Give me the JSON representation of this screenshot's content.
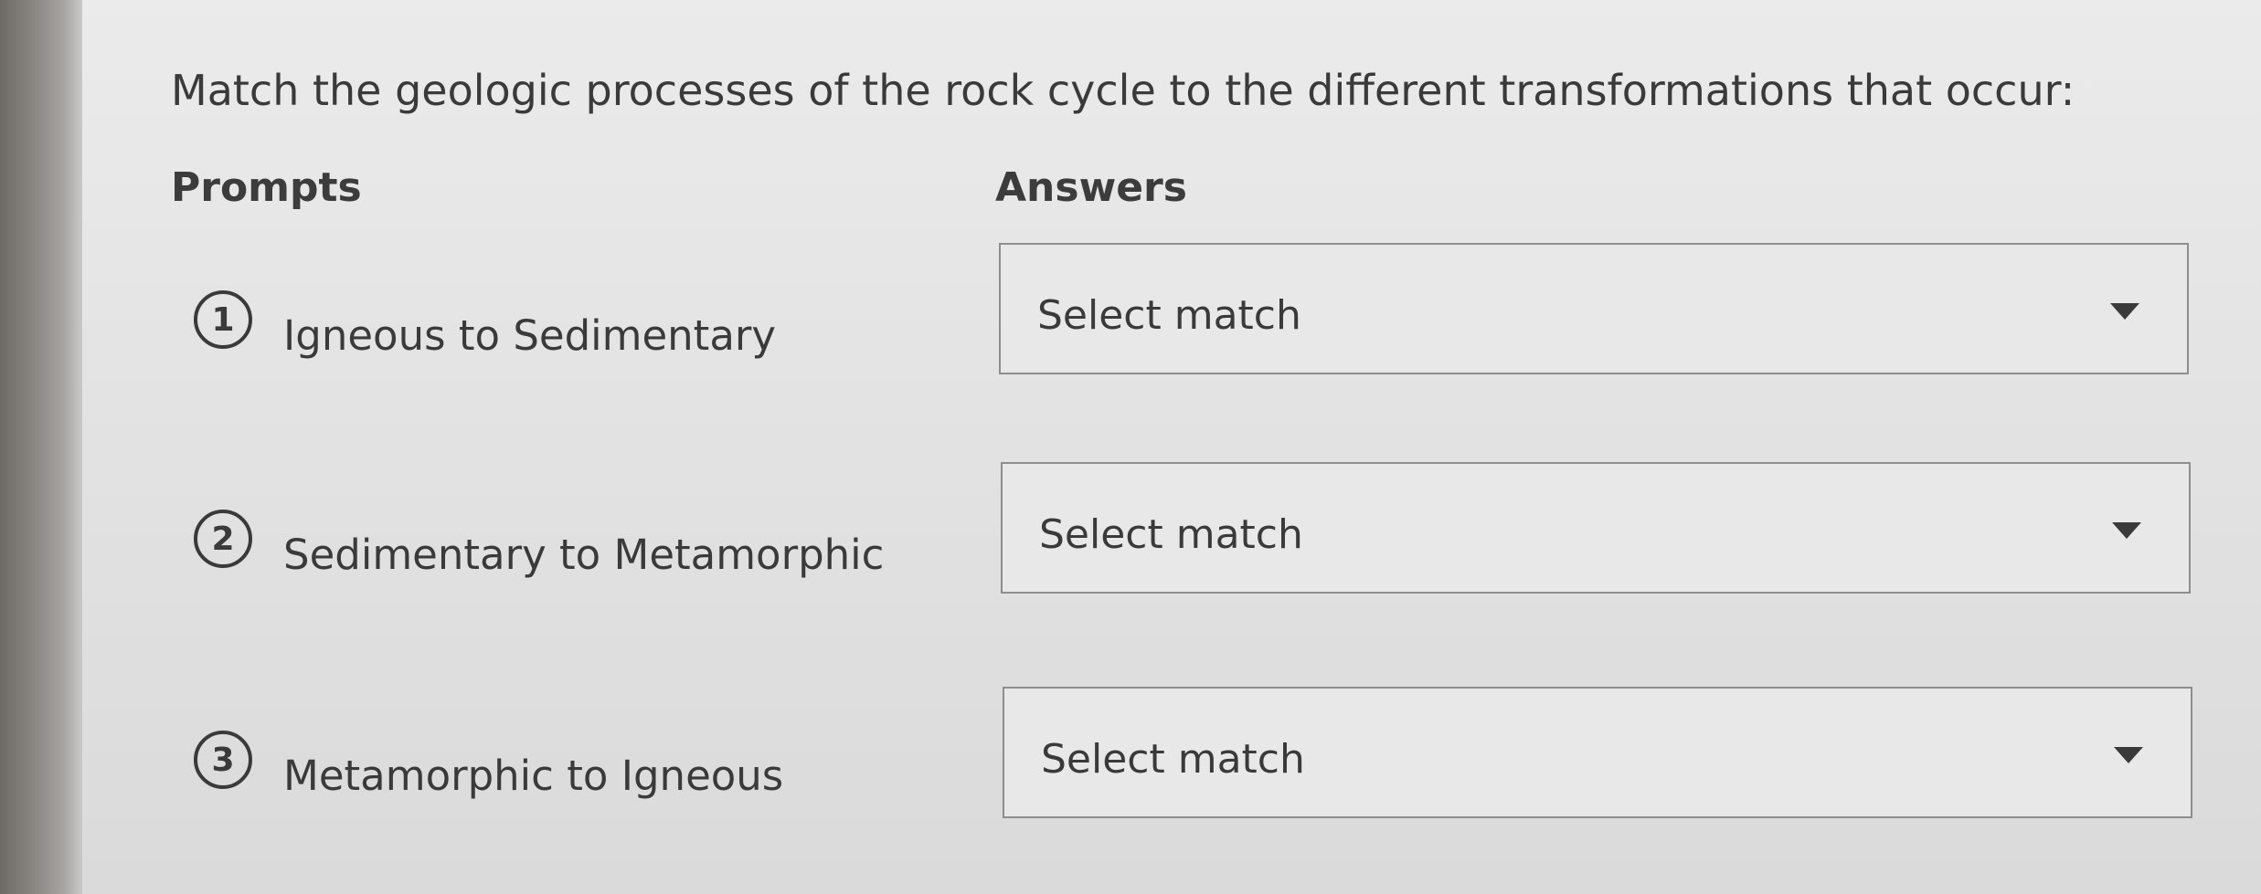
{
  "question": {
    "text": "Match the geologic processes of the rock cycle to the different transformations that occur:"
  },
  "columns": {
    "prompts_label": "Prompts",
    "answers_label": "Answers"
  },
  "rows": [
    {
      "number": "1",
      "prompt": "Igneous to Sedimentary",
      "select_value": "Select match"
    },
    {
      "number": "2",
      "prompt": "Sedimentary to Metamorphic",
      "select_value": "Select match"
    },
    {
      "number": "3",
      "prompt": "Metamorphic to Igneous",
      "select_value": "Select match"
    }
  ],
  "icons": {
    "dropdown": "caret-down-icon"
  }
}
